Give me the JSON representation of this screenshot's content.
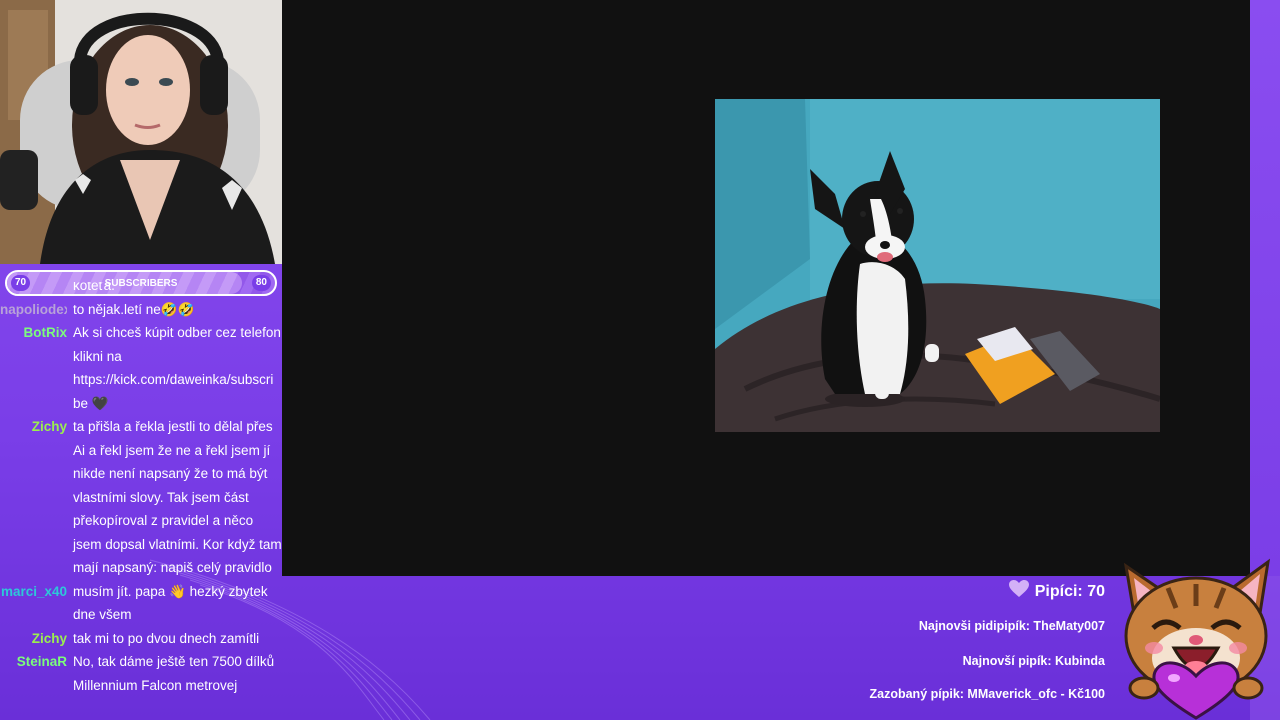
{
  "subscriber_goal": {
    "current": "70",
    "target": "80",
    "label": "SUBSCRIBERS",
    "progress_fraction": 0.875
  },
  "chat": {
    "messages": [
      {
        "user": "",
        "user_color": "#ffffff",
        "lines": [
          "koteťa."
        ]
      },
      {
        "user": "napoliodex",
        "user_color": "#b8a2d8",
        "lines": [
          "to nějak.letí ne🤣🤣"
        ]
      },
      {
        "user": "BotRix",
        "user_color": "#7CFC7C",
        "lines": [
          "Ak si chceš kúpit odber cez telefon",
          "klikni na",
          "https://kick.com/daweinka/subscri",
          "be 🖤"
        ]
      },
      {
        "user": "Zichy",
        "user_color": "#9BEF4E",
        "lines": [
          "ta přišla a řekla jestli to dělal přes",
          "Ai a řekl jsem že ne a řekl jsem jí",
          "nikde není napsaný že to má být",
          "vlastními slovy. Tak jsem část",
          "překopíroval z pravidel a něco",
          "jsem dopsal vlatními. Kor když tam",
          "mají napsaný: napiš celý pravidlo"
        ]
      },
      {
        "user": "marci_x40",
        "user_color": "#2EC7D8",
        "lines": [
          "musím jít. papa 👋 hezký zbytek",
          "dne všem"
        ]
      },
      {
        "user": "Zichy",
        "user_color": "#9BEF4E",
        "lines": [
          "tak mi to po dvou dnech zamítli"
        ]
      },
      {
        "user": "SteinaR",
        "user_color": "#7CFC7C",
        "lines": [
          "No, tak dáme ještě ten 7500 dílků",
          "Millennium Falcon metrovej"
        ]
      }
    ]
  },
  "stats": {
    "pipici": "Pipíci: 70",
    "newest_sub": "Najnovši pidipipík: TheMaty007",
    "newest_follower": "Najnovší pipík: Kubinda",
    "donor": "Zazobaný pípik: MMaverick_ofc - Kč100"
  },
  "colors": {
    "accent": "#8a4df0",
    "stage": "#111111",
    "heart": "#c9a2f5"
  },
  "icons": {
    "stats_heart": "heart-icon",
    "mascot": "cat-mascot"
  }
}
